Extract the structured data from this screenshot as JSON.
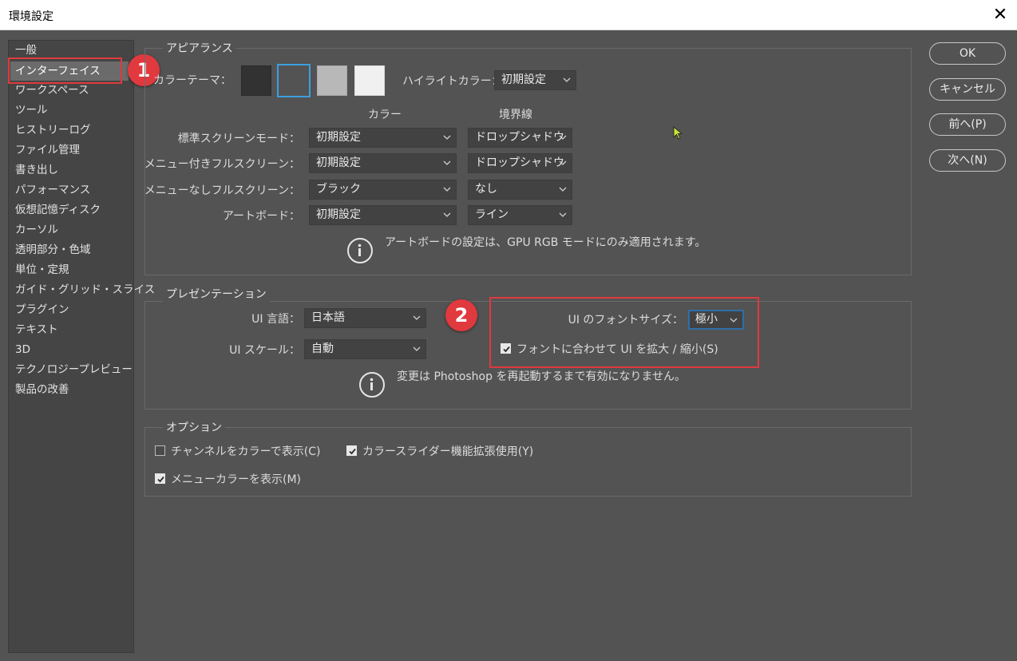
{
  "window": {
    "title": "環境設定",
    "close_glyph": "✕"
  },
  "sidebar": {
    "items": [
      {
        "label": "一般"
      },
      {
        "label": "インターフェイス"
      },
      {
        "label": "ワークスペース"
      },
      {
        "label": "ツール"
      },
      {
        "label": "ヒストリーログ"
      },
      {
        "label": "ファイル管理"
      },
      {
        "label": "書き出し"
      },
      {
        "label": "パフォーマンス"
      },
      {
        "label": "仮想記憶ディスク"
      },
      {
        "label": "カーソル"
      },
      {
        "label": "透明部分・色域"
      },
      {
        "label": "単位・定規"
      },
      {
        "label": "ガイド・グリッド・スライス"
      },
      {
        "label": "プラグイン"
      },
      {
        "label": "テキスト"
      },
      {
        "label": "3D"
      },
      {
        "label": "テクノロジープレビュー"
      },
      {
        "label": "製品の改善"
      }
    ],
    "selected_index": 1
  },
  "annotations": {
    "badge1": "1",
    "badge2": "2",
    "color": "#e0393e"
  },
  "appearance": {
    "legend": "アピアランス",
    "color_theme_label": "カラーテーマ：",
    "theme_swatches": [
      "#323232",
      "#535353",
      "#b8b8b8",
      "#f0f0f0"
    ],
    "selected_theme_index": 1,
    "highlight_label": "ハイライトカラー：",
    "highlight_value": "初期設定",
    "col_color": "カラー",
    "col_border": "境界線",
    "rows": [
      {
        "label": "標準スクリーンモード：",
        "color": "初期設定",
        "border": "ドロップシャドウ"
      },
      {
        "label": "メニュー付きフルスクリーン：",
        "color": "初期設定",
        "border": "ドロップシャドウ"
      },
      {
        "label": "メニューなしフルスクリーン：",
        "color": "ブラック",
        "border": "なし"
      },
      {
        "label": "アートボード：",
        "color": "初期設定",
        "border": "ライン"
      }
    ],
    "note": "アートボードの設定は、GPU RGB モードにのみ適用されます。"
  },
  "presentation": {
    "legend": "プレゼンテーション",
    "ui_language_label": "UI 言語：",
    "ui_language_value": "日本語",
    "ui_scale_label": "UI スケール：",
    "ui_scale_value": "自動",
    "font_size_label": "UI のフォントサイズ：",
    "font_size_value": "極小",
    "scale_checkbox_label": "フォントに合わせて UI を拡大 / 縮小(S)",
    "scale_checkbox_checked": true,
    "note": "変更は Photoshop を再起動するまで有効になりません。"
  },
  "options": {
    "legend": "オプション",
    "channels_color": {
      "label": "チャンネルをカラーで表示(C)",
      "checked": false
    },
    "color_slider": {
      "label": "カラースライダー機能拡張使用(Y)",
      "checked": true
    },
    "menu_color": {
      "label": "メニューカラーを表示(M)",
      "checked": true
    }
  },
  "buttons": {
    "ok": "OK",
    "cancel": "キャンセル",
    "prev": "前へ(P)",
    "next": "次へ(N)"
  }
}
